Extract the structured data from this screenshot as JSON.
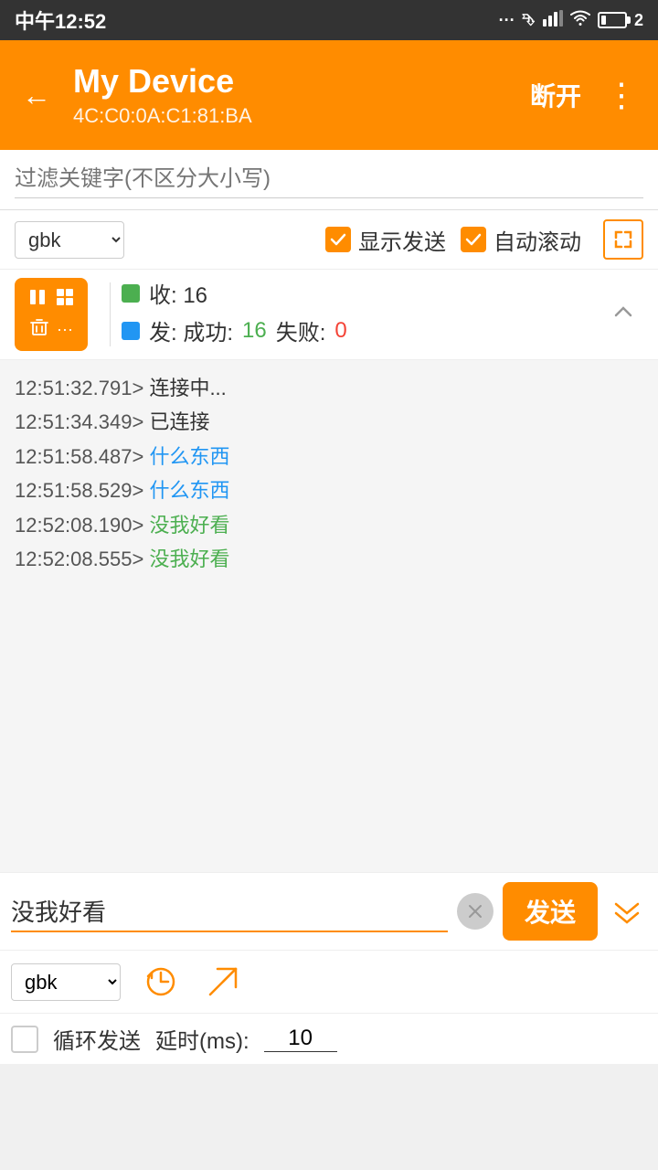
{
  "statusBar": {
    "time": "中午12:52",
    "battery": "2"
  },
  "appBar": {
    "backLabel": "←",
    "deviceName": "My Device",
    "deviceMac": "4C:C0:0A:C1:81:BA",
    "disconnectLabel": "断开",
    "moreLabel": "⋮"
  },
  "filterBar": {
    "placeholder": "过滤关键字(不区分大小写)"
  },
  "controlsBar": {
    "encoding": "gbk",
    "showSendLabel": "显示发送",
    "autoScrollLabel": "自动滚动"
  },
  "stats": {
    "recvLabel": "收: 16",
    "sendLabel": "发: 成功: 16 失败: 0",
    "successCount": "16",
    "failCount": "0"
  },
  "log": {
    "lines": [
      {
        "time": "12:51:32.791>",
        "msg": " 连接中...",
        "type": "normal"
      },
      {
        "time": "12:51:34.349>",
        "msg": " 已连接",
        "type": "normal"
      },
      {
        "time": "12:51:58.487>",
        "msg": " 什么东西",
        "type": "blue"
      },
      {
        "time": "12:51:58.529>",
        "msg": " 什么东西",
        "type": "blue"
      },
      {
        "time": "12:52:08.190>",
        "msg": " 没我好看",
        "type": "green"
      },
      {
        "time": "12:52:08.555>",
        "msg": " 没我好看",
        "type": "green"
      }
    ]
  },
  "bottomInput": {
    "messageValue": "没我好看",
    "sendLabel": "发送",
    "encoding": "gbk",
    "loopLabel": "循环发送",
    "delayLabel": "延时(ms):",
    "delayValue": "10"
  }
}
